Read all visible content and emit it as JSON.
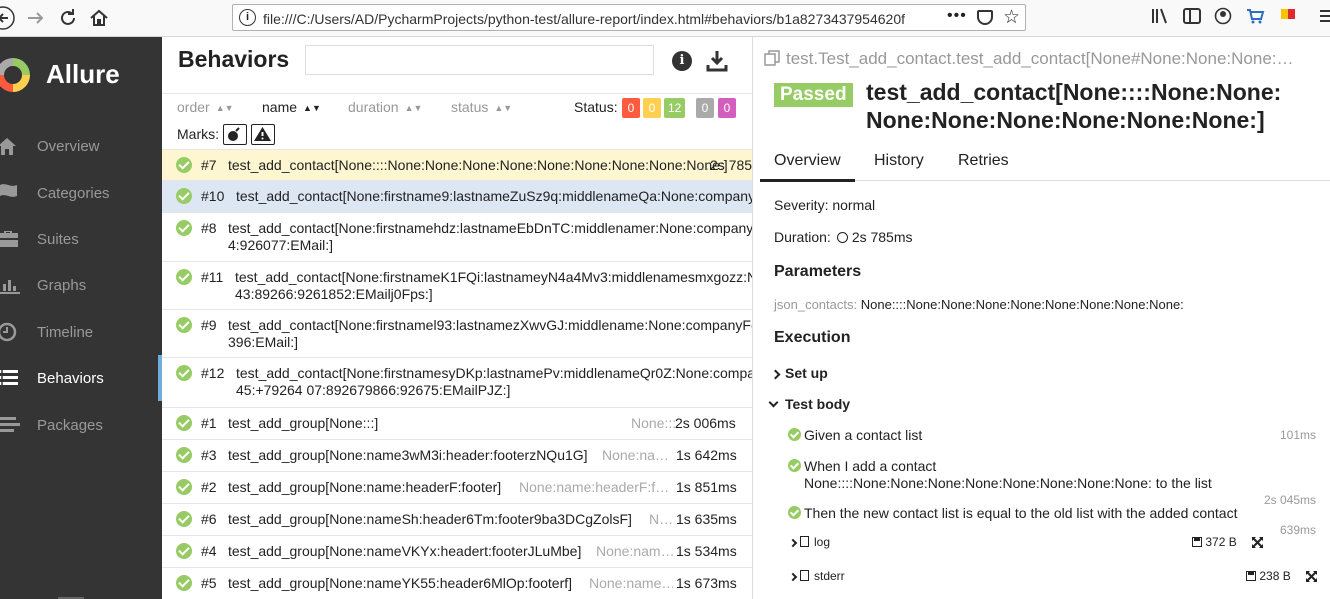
{
  "browser": {
    "url": "file:///C:/Users/AD/PycharmProjects/python-test/allure-report/index.html#behaviors/b1a8273437954620f",
    "more": "•••"
  },
  "sidebar": {
    "logo": "Allure",
    "items": [
      {
        "label": "Overview",
        "icon": "home-icon"
      },
      {
        "label": "Categories",
        "icon": "flag-icon"
      },
      {
        "label": "Suites",
        "icon": "briefcase-icon"
      },
      {
        "label": "Graphs",
        "icon": "bar-chart-icon"
      },
      {
        "label": "Timeline",
        "icon": "clock-icon"
      },
      {
        "label": "Behaviors",
        "icon": "list-icon",
        "active": true
      },
      {
        "label": "Packages",
        "icon": "align-left-icon"
      }
    ]
  },
  "behaviors": {
    "title": "Behaviors",
    "search_placeholder": "",
    "sort": {
      "order": "order",
      "name": "name",
      "duration": "duration",
      "status": "status"
    },
    "status_label": "Status:",
    "status_counts": {
      "failed": "0",
      "broken": "0",
      "passed": "12",
      "skipped": "0",
      "unknown": "0"
    },
    "marks_label": "Marks:",
    "rows": [
      {
        "num": "#7",
        "name": "test_add_contact[None::::None:None:None:None:None:None:None:None:None:]",
        "param": "…",
        "duration": "2s 785",
        "state": "sel"
      },
      {
        "num": "#10",
        "name": "test_add_contact[None:firstname9:lastnameZuSz9q:middlenameQa:None:company",
        "state": "hov"
      },
      {
        "num": "#8",
        "name": "test_add_contact[None:firstnamehdz:lastnameEbDnTC:middlenamer:None:company",
        "name2": "4:926077:EMail:]"
      },
      {
        "num": "#11",
        "name": "test_add_contact[None:firstnameK1FQi:lastnameyN4a4Mv3:middlenamesmxgozz:N",
        "name2": "43:89266:9261852:EMailj0Fps:]"
      },
      {
        "num": "#9",
        "name": "test_add_contact[None:firstnamel93:lastnamezXwvGJ:middlename:None:companyF(",
        "name2": "396:EMail:]"
      },
      {
        "num": "#12",
        "name": "test_add_contact[None:firstnamesyDKp:lastnamePv:middlenameQr0Z:None:compa",
        "name2": "45:+79264 07:892679866:92675:EMailPJZ:]"
      },
      {
        "num": "#1",
        "name": "test_add_group[None:::]",
        "param": "None:::",
        "duration": "2s 006ms"
      },
      {
        "num": "#3",
        "name": "test_add_group[None:name3wM3i:header:footerzNQu1G]",
        "param": "None:na…",
        "duration": "1s 642ms"
      },
      {
        "num": "#2",
        "name": "test_add_group[None:name:headerF:footer]",
        "param": "None:name:headerF:f…",
        "duration": "1s 851ms"
      },
      {
        "num": "#6",
        "name": "test_add_group[None:nameSh:header6Tm:footer9ba3DCgZolsF]",
        "param": "N…",
        "duration": "1s 635ms"
      },
      {
        "num": "#4",
        "name": "test_add_group[None:nameVKYx:headert:footerJLuMbe]",
        "param": "None:nam…",
        "duration": "1s 534ms"
      },
      {
        "num": "#5",
        "name": "test_add_group[None:nameYK55:header6MlOp:footerf]",
        "param": "None:name…",
        "duration": "1s 673ms"
      }
    ]
  },
  "result": {
    "crumb": "test.Test_add_contact.test_add_contact[None#None:None:None:…",
    "status": "Passed",
    "title": "test_add_contact[None::::None:None: None:None:None:None:None:None:]",
    "tabs": [
      "Overview",
      "History",
      "Retries"
    ],
    "severity": "Severity: normal",
    "duration_label": "Duration:",
    "duration": "2s 785ms",
    "params_heading": "Parameters",
    "param_name": "json_contacts:",
    "param_value": "None::::None:None:None:None:None:None:None:None:",
    "execution_heading": "Execution",
    "setup": "Set up",
    "testbody": "Test body",
    "steps": [
      {
        "text": "Given a contact list",
        "duration": "101ms"
      },
      {
        "text": "When I add a contact",
        "text2": "None::::None:None:None:None:None:None:None:None: to the list",
        "duration": "2s 045ms"
      },
      {
        "text": "Then the new contact list is equal to the old list with the added contact",
        "duration": "639ms"
      }
    ],
    "attachments": [
      {
        "name": "log",
        "size": "372 B"
      },
      {
        "name": "stderr",
        "size": "238 B"
      }
    ]
  },
  "colors": {
    "passed": "#97cc64",
    "failed": "#fd5a3e",
    "broken": "#ffd050",
    "skipped": "#aaaaaa",
    "unknown": "#d35ebe",
    "sidebar": "#343434"
  }
}
